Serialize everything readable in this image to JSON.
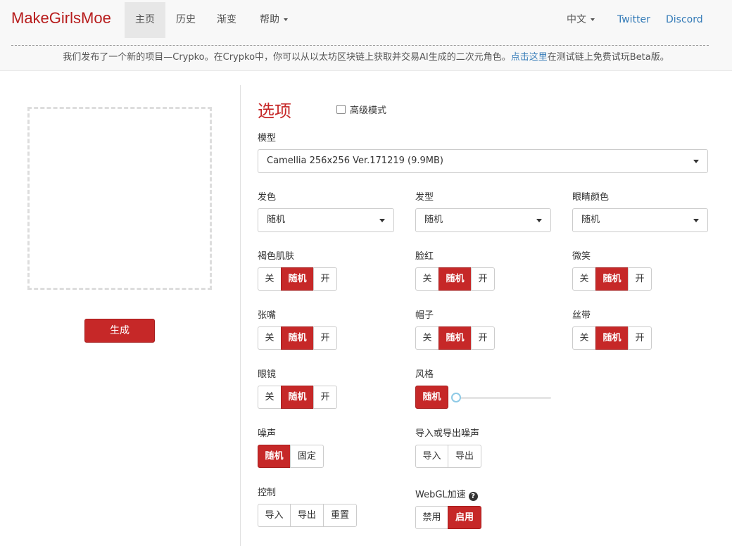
{
  "brand": "MakeGirlsMoe",
  "nav": {
    "home": "主页",
    "history": "历史",
    "gradient": "渐变",
    "help": "帮助",
    "language": "中文",
    "twitter": "Twitter",
    "discord": "Discord"
  },
  "announcement": {
    "text_before": "我们发布了一个新的项目—Crypko。在Crypko中，你可以从以太坊区块链上获取并交易AI生成的二次元角色。",
    "link": "点击这里",
    "text_after": "在测试链上免费试玩Beta版。"
  },
  "left": {
    "generate_label": "生成"
  },
  "options": {
    "title": "选项",
    "advanced_label": "高级模式",
    "model_label": "模型",
    "model_value": "Camellia 256x256 Ver.171219 (9.9MB)",
    "hair_color_label": "发色",
    "hair_color_value": "随机",
    "hair_style_label": "发型",
    "hair_style_value": "随机",
    "eye_color_label": "眼睛颜色",
    "eye_color_value": "随机",
    "dark_skin_label": "褐色肌肤",
    "blush_label": "脸红",
    "smile_label": "微笑",
    "open_mouth_label": "张嘴",
    "hat_label": "帽子",
    "ribbon_label": "丝带",
    "glasses_label": "眼镜",
    "style_label": "风格",
    "noise_label": "噪声",
    "noise_io_label": "导入或导出噪声",
    "control_label": "控制",
    "webgl_label": "WebGL加速",
    "off": "关",
    "random": "随机",
    "on": "开",
    "fixed": "固定",
    "import": "导入",
    "export": "导出",
    "reset": "重置",
    "disable": "禁用",
    "enable": "启用"
  }
}
